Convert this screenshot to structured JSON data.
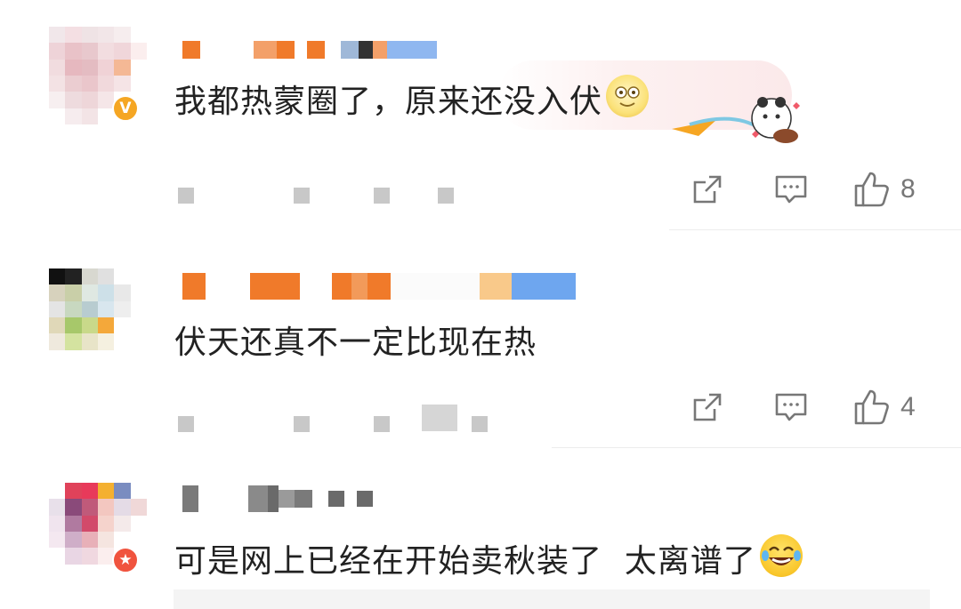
{
  "comments": [
    {
      "text": "我都热蒙圈了，原来还没入伏",
      "badge": "V",
      "emoji": "smiling-face-icon",
      "likes": "8"
    },
    {
      "text": "伏天还真不一定比现在热",
      "badge": "",
      "emoji": "",
      "likes": "4"
    },
    {
      "text": "可是网上已经在开始卖秋装了  太离谱了",
      "badge": "★",
      "emoji": "laughing-crying-face-icon",
      "likes": ""
    }
  ],
  "colors": {
    "text": "#222222",
    "secondary": "#777777",
    "badge_gold": "#f5a623",
    "badge_red": "#f0533e",
    "divider": "#ececec"
  }
}
